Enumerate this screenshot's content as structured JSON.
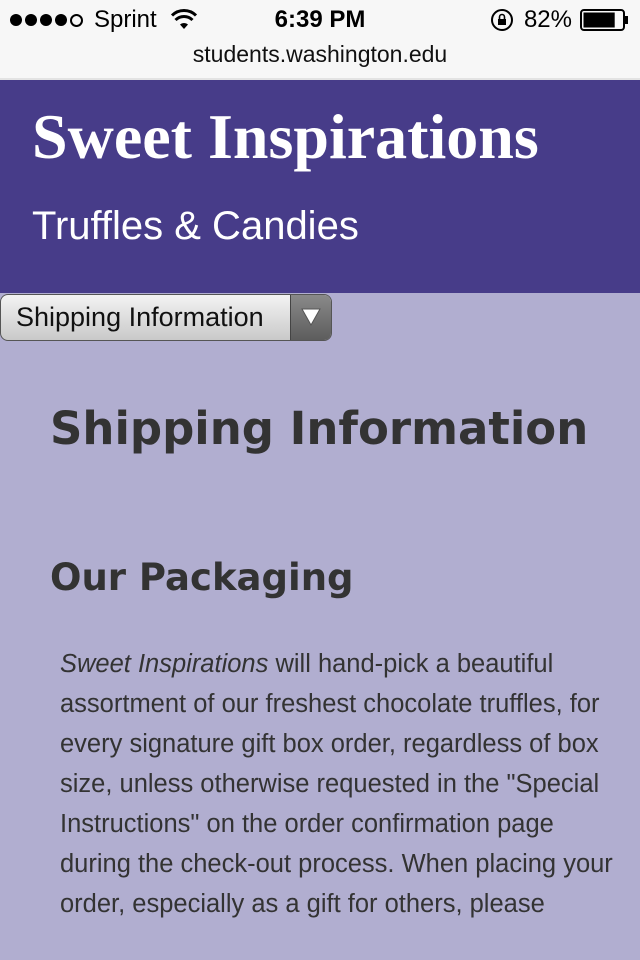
{
  "status_bar": {
    "carrier": "Sprint",
    "time": "6:39 PM",
    "battery_percent": "82%",
    "signal_strength": 4,
    "battery_level": 0.82
  },
  "url_bar": {
    "domain": "students.washington.edu"
  },
  "header": {
    "title": "Sweet Inspirations",
    "subtitle": "Truffles & Candies",
    "background_color": "#473c89"
  },
  "nav_select": {
    "selected": "Shipping Information"
  },
  "main": {
    "page_title": "Shipping Information",
    "section_heading": "Our Packaging",
    "body_lead": "Sweet Inspirations",
    "body_rest": " will hand-pick a beautiful assortment of our freshest chocolate truffles, for every signature gift box order, regardless of box size, unless otherwise requested in the \"Special Instructions\" on the order confirmation page during the check-out process. When placing your order, especially as a gift for others, please",
    "background_color": "#b1aed0"
  }
}
